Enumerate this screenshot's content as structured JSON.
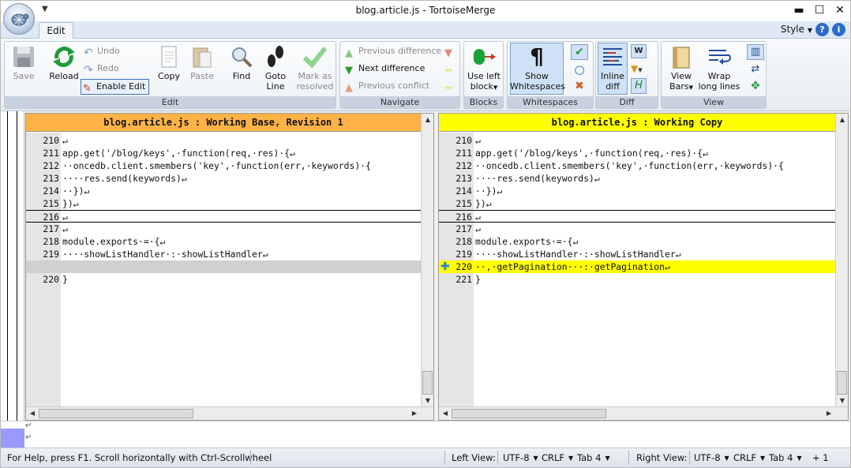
{
  "window": {
    "title": "blog.article.js - TortoiseMerge",
    "minimize": "▬",
    "maximize": "☐",
    "close": "✕"
  },
  "tabs": {
    "edit": "Edit"
  },
  "style_menu": "Style",
  "ribbon": {
    "edit_group": {
      "label": "Edit",
      "save": "Save",
      "reload": "Reload",
      "undo": "Undo",
      "redo": "Redo",
      "enable_edit": "Enable Edit",
      "copy": "Copy",
      "paste": "Paste",
      "find": "Find",
      "goto_line_1": "Goto",
      "goto_line_2": "Line",
      "mark_resolved_1": "Mark as",
      "mark_resolved_2": "resolved"
    },
    "navigate_group": {
      "label": "Navigate",
      "previous_difference": "Previous difference",
      "next_difference": "Next difference",
      "previous_conflict": "Previous conflict"
    },
    "blocks_group": {
      "label": "Blocks",
      "use_left_1": "Use left",
      "use_left_2": "block"
    },
    "whitespaces_group": {
      "label": "Whitespaces",
      "show_1": "Show",
      "show_2": "Whitespaces"
    },
    "diff_group": {
      "label": "Diff",
      "inline_1": "Inline",
      "inline_2": "diff"
    },
    "view_group": {
      "label": "View",
      "view_bars_1": "View",
      "view_bars_2": "Bars",
      "wrap_1": "Wrap",
      "wrap_2": "long lines"
    }
  },
  "left_pane": {
    "header": "blog.article.js : Working Base, Revision 1",
    "header_color": "#ffb347",
    "lines": [
      {
        "num": "210",
        "text": "↵"
      },
      {
        "num": "211",
        "text": "app.get('/blog/keys',·function(req,·res)·{↵"
      },
      {
        "num": "212",
        "text": "··oncedb.client.smembers('key',·function(err,·keywords)·{"
      },
      {
        "num": "213",
        "text": "····res.send(keywords)↵"
      },
      {
        "num": "214",
        "text": "··})↵"
      },
      {
        "num": "215",
        "text": "})↵"
      },
      {
        "num": "216",
        "text": "↵"
      },
      {
        "num": "217",
        "text": "↵"
      },
      {
        "num": "218",
        "text": "module.exports·=·{↵"
      },
      {
        "num": "219",
        "text": "····showListHandler·:·showListHandler↵"
      },
      {
        "num": "",
        "text": ""
      },
      {
        "num": "220",
        "text": "}"
      }
    ]
  },
  "right_pane": {
    "header": "blog.article.js : Working Copy",
    "header_color": "#ffff00",
    "lines": [
      {
        "num": "210",
        "text": "↵"
      },
      {
        "num": "211",
        "text": "app.get('/blog/keys',·function(req,·res)·{↵"
      },
      {
        "num": "212",
        "text": "··oncedb.client.smembers('key',·function(err,·keywords)·{"
      },
      {
        "num": "213",
        "text": "····res.send(keywords)↵"
      },
      {
        "num": "214",
        "text": "··})↵"
      },
      {
        "num": "215",
        "text": "})↵"
      },
      {
        "num": "216",
        "text": "↵"
      },
      {
        "num": "217",
        "text": "↵"
      },
      {
        "num": "218",
        "text": "module.exports·=·{↵"
      },
      {
        "num": "219",
        "text": "····showListHandler·:·showListHandler↵"
      },
      {
        "num": "220",
        "text": "··,·getPagination···:·getPagination↵"
      },
      {
        "num": "221",
        "text": "}"
      }
    ]
  },
  "bottom_view": {
    "line1": "↵",
    "line2": "↵"
  },
  "statusbar": {
    "help": "For Help, press F1. Scroll horizontally with Ctrl-Scrollwheel",
    "left_view": "Left View:",
    "left_encoding": "UTF-8",
    "left_eol": "CRLF",
    "left_tab": "Tab 4",
    "right_view": "Right View:",
    "right_encoding": "UTF-8",
    "right_eol": "CRLF",
    "right_tab": "Tab 4",
    "diff_count": "+ 1"
  },
  "colors": {
    "added_line": "#ffff00",
    "placeholder_line": "#d0d0d0",
    "gutter": "#e5e5e5"
  }
}
